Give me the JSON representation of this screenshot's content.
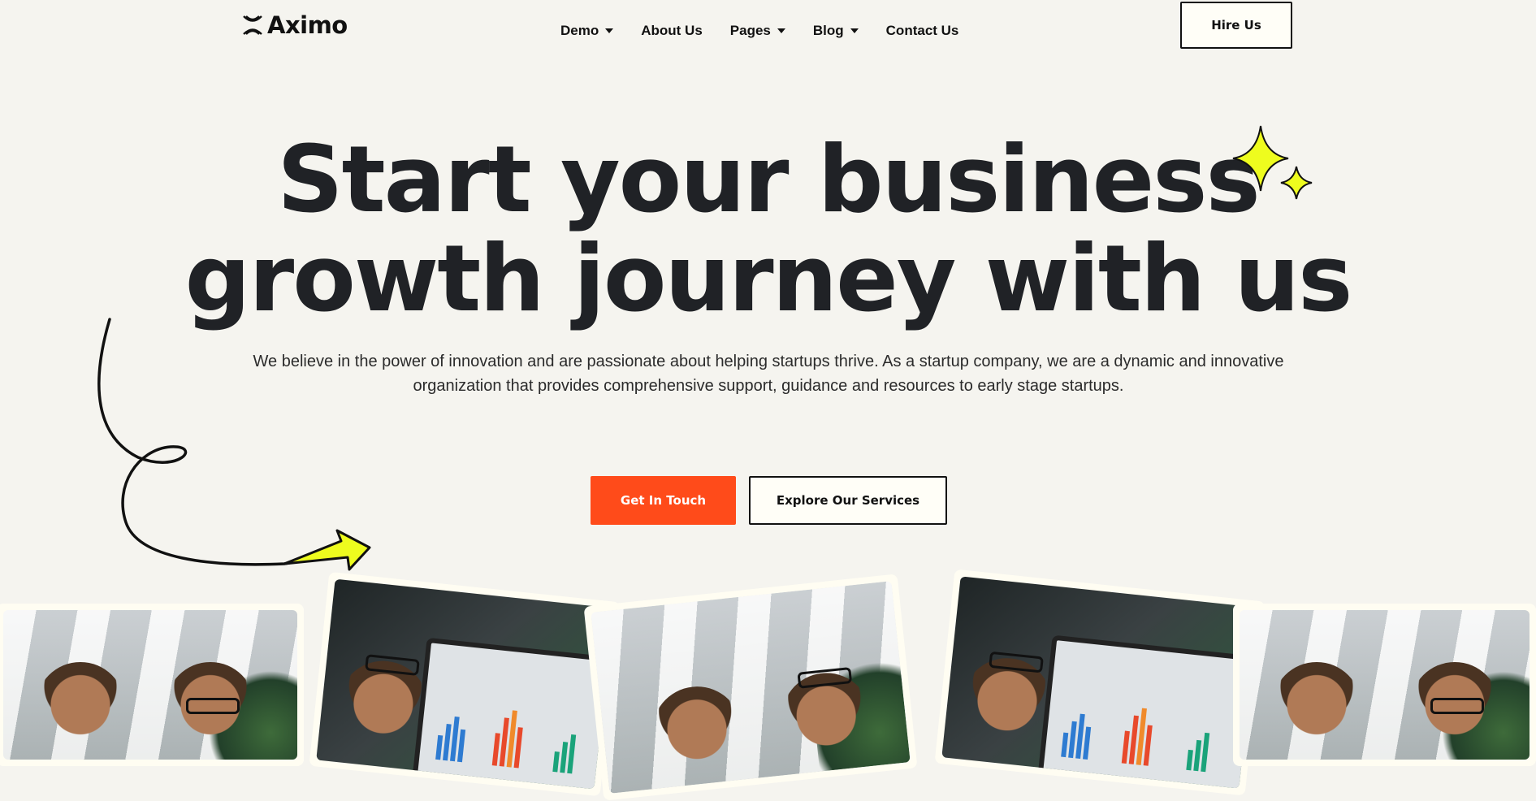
{
  "header": {
    "brand": "Aximo",
    "nav": [
      {
        "label": "Demo",
        "has_dropdown": true
      },
      {
        "label": "About Us",
        "has_dropdown": false
      },
      {
        "label": "Pages",
        "has_dropdown": true
      },
      {
        "label": "Blog",
        "has_dropdown": true
      },
      {
        "label": "Contact Us",
        "has_dropdown": false
      }
    ],
    "cta_label": "Hire Us"
  },
  "hero": {
    "title_line1": "Start your business",
    "title_line2": "growth journey with us",
    "description": "We believe in the power of innovation and are passionate about helping startups thrive. As a startup company, we are a dynamic and innovative organization that provides comprehensive support, guidance and resources to early stage startups.",
    "primary_button": "Get In Touch",
    "secondary_button": "Explore Our Services"
  },
  "icons": {
    "logo": "aximo-logo-icon",
    "sparkles": "sparkle-icon",
    "arrow": "swirl-arrow-icon",
    "dropdown": "chevron-down-icon"
  },
  "colors": {
    "background": "#f5f4ef",
    "accent": "#ff4b1a",
    "highlight": "#eefc1e",
    "text": "#202226"
  }
}
